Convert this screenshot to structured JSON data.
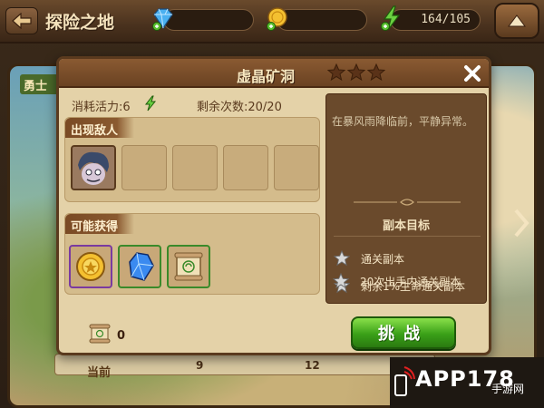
{
  "topbar": {
    "title": "探险之地",
    "energy": "164/105",
    "accent": "#f4e2bc"
  },
  "map": {
    "stage_label": "勇士",
    "current_label": "当前",
    "ticks": [
      "9",
      "12"
    ]
  },
  "dialog": {
    "title": "虚晶矿洞",
    "stars": 3,
    "stamina_label": "消耗活力:6",
    "remaining_label": "剩余次数:20/20",
    "enemies_title": "出现敌人",
    "enemy_slot_count": 5,
    "rewards_title": "可能获得",
    "rewards": [
      {
        "icon": "gold-coin-icon",
        "border": "#7a3aa0"
      },
      {
        "icon": "blue-crystal-icon",
        "border": "#3a8a2a"
      },
      {
        "icon": "scroll-icon",
        "border": "#3a8a2a"
      }
    ],
    "description": "在暴风雨降临前，平静异常。",
    "objectives_title": "副本目标",
    "objectives": [
      "通关副本",
      "剩余1%生命通关副本",
      "20次出手内通关副本"
    ],
    "ticket_count": "0",
    "challenge_label": "挑战"
  },
  "watermark": {
    "title": "APP178",
    "subtitle": "手游网"
  }
}
